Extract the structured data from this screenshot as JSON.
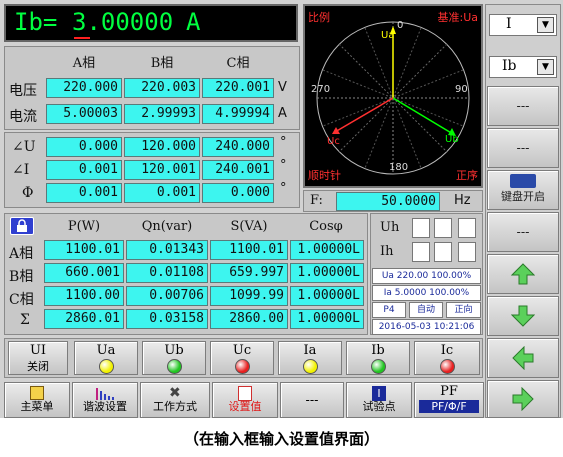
{
  "header": {
    "label": "Ib=",
    "value": "3.00000",
    "unit": "A"
  },
  "voltage_current": {
    "columns": [
      "A相",
      "B相",
      "C相"
    ],
    "rows": [
      {
        "label": "电压",
        "values": [
          "220.000",
          "220.003",
          "220.001"
        ],
        "unit": "V"
      },
      {
        "label": "电流",
        "values": [
          "5.00003",
          "2.99993",
          "4.99994"
        ],
        "unit": "A"
      }
    ]
  },
  "angles": {
    "rows": [
      {
        "label": "∠U",
        "values": [
          "0.000",
          "120.000",
          "240.000"
        ],
        "unit": "°"
      },
      {
        "label": "∠I",
        "values": [
          "0.001",
          "120.001",
          "240.001"
        ],
        "unit": "°"
      },
      {
        "label": "Φ",
        "values": [
          "0.001",
          "0.001",
          "0.000"
        ],
        "unit": "°"
      }
    ]
  },
  "phasor": {
    "title": "比例",
    "reference": "基准:Ua",
    "deg0": "0",
    "deg90": "90",
    "deg180": "180",
    "deg270": "270",
    "rotation": "顺时针",
    "sequence": "正序",
    "labels": {
      "ua": "Ua",
      "ub": "Ub",
      "uc": "Uc"
    },
    "colors": {
      "ua": "#ffff00",
      "ub": "#00ff00",
      "uc": "#ff3030"
    }
  },
  "frequency": {
    "label": "F:",
    "value": "50.0000",
    "unit": "Hz"
  },
  "power": {
    "lock_icon": "lock-icon",
    "columns": [
      "P(W)",
      "Qn(var)",
      "S(VA)",
      "Cosφ"
    ],
    "rows": [
      {
        "label": "A相",
        "values": [
          "1100.01",
          "0.01343",
          "1100.01",
          "1.00000L"
        ]
      },
      {
        "label": "B相",
        "values": [
          "660.001",
          "0.01108",
          "659.997",
          "1.00000L"
        ]
      },
      {
        "label": "C相",
        "values": [
          "1100.00",
          "0.00706",
          "1099.99",
          "1.00000L"
        ]
      },
      {
        "label": "Σ",
        "values": [
          "2860.01",
          "0.03158",
          "2860.00",
          "1.00000L"
        ]
      }
    ]
  },
  "harmonics": {
    "uh": "Uh",
    "ih": "Ih"
  },
  "status": {
    "ua_line": "Ua 220.00 100.00%",
    "ia_line": "Ia 5.0000 100.00%",
    "mode": "P4",
    "auto": "自动",
    "dir": "正向",
    "datetime": "2016-05-03 10:21:06"
  },
  "indicators": {
    "ui": {
      "label": "UI",
      "state": "关闭"
    },
    "items": [
      {
        "label": "Ua",
        "color": "#f2f200"
      },
      {
        "label": "Ub",
        "color": "#22c622"
      },
      {
        "label": "Uc",
        "color": "#e82020"
      },
      {
        "label": "Ia",
        "color": "#f2f200"
      },
      {
        "label": "Ib",
        "color": "#22c622"
      },
      {
        "label": "Ic",
        "color": "#e82020"
      }
    ]
  },
  "bottom": {
    "main_menu": "主菜单",
    "harmonic": "谐波设置",
    "mode": "工作方式",
    "setvalue": "设置值",
    "dashes": "---",
    "testpoint": "试验点",
    "pf": "PF",
    "pf_sub": "PF/Φ/F"
  },
  "right": {
    "select1": "I",
    "select2": "Ib",
    "dash1": "---",
    "dash2": "---",
    "keyboard": "键盘开启",
    "dash3": "---"
  },
  "caption": "（在输入框输入设置值界面）"
}
